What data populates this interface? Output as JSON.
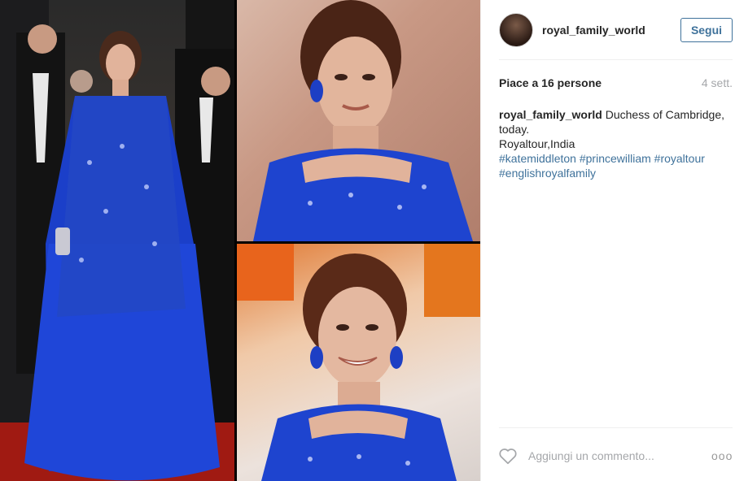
{
  "post": {
    "images": [
      {
        "name": "full-length-photo",
        "alt": ""
      },
      {
        "name": "portrait-photo-top",
        "alt": ""
      },
      {
        "name": "portrait-photo-bottom",
        "alt": ""
      }
    ]
  },
  "header": {
    "username": "royal_family_world",
    "follow_label": "Segui"
  },
  "stats": {
    "likes": "Piace a 16 persone",
    "time": "4 sett."
  },
  "caption": {
    "username": "royal_family_world",
    "text_line1": "Duchess of Cambridge, today.",
    "text_line2": "Royaltour,India",
    "hashtags": [
      "#katemiddleton",
      "#princewilliam",
      "#royaltour",
      "#englishroyalfamily"
    ]
  },
  "comment": {
    "placeholder": "Aggiungi un commento...",
    "more": "ooo"
  },
  "colors": {
    "link": "#3f729b",
    "muted": "#a5a7aa",
    "text": "#262626",
    "divider": "#efefef"
  }
}
